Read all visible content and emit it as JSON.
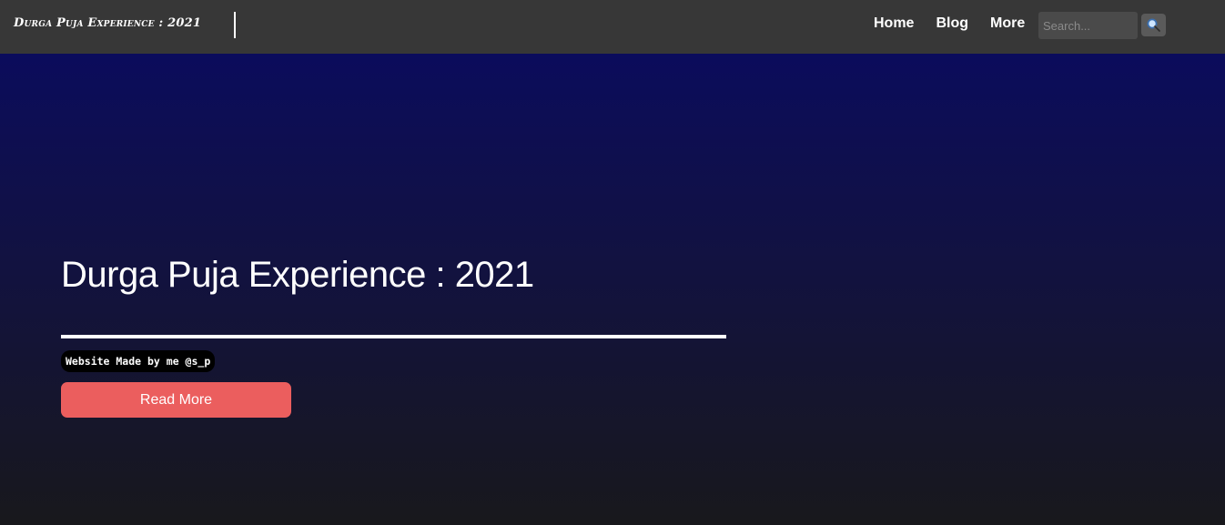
{
  "navbar": {
    "brand": "Durga Puja Experience : 2021",
    "links": [
      {
        "label": "Home"
      },
      {
        "label": "Blog"
      },
      {
        "label": "More"
      }
    ],
    "search": {
      "placeholder": "Search...",
      "value": "",
      "button_icon": "magnifier-icon"
    }
  },
  "hero": {
    "title": "Durga Puja Experience : 2021",
    "credit": "Website Made by me @s_p",
    "cta_label": "Read More"
  },
  "colors": {
    "navbar_bg": "#373737",
    "hero_gradient_top": "#0b0c5c",
    "hero_gradient_bottom": "#18181c",
    "cta_bg": "#eb5e5e"
  }
}
